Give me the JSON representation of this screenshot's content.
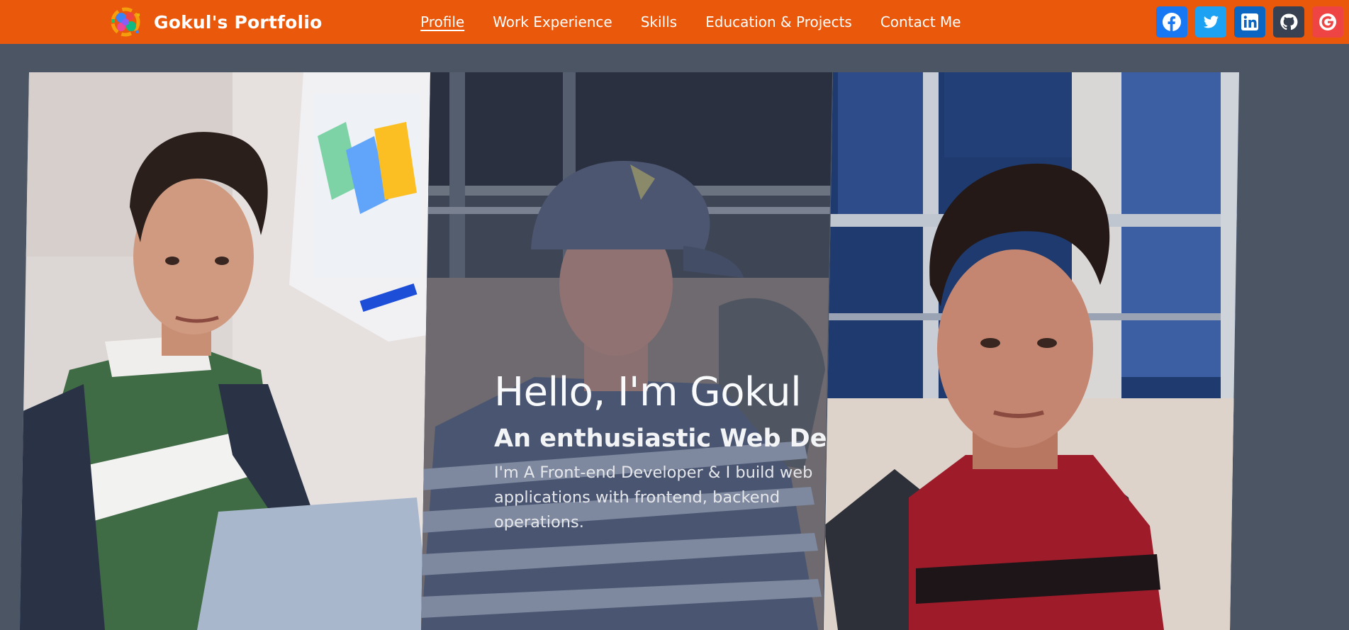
{
  "navbar": {
    "brand": "Gokul's Portfolio",
    "links": [
      {
        "label": "Profile",
        "active": true
      },
      {
        "label": "Work Experience",
        "active": false
      },
      {
        "label": "Skills",
        "active": false
      },
      {
        "label": "Education & Projects",
        "active": false
      },
      {
        "label": "Contact Me",
        "active": false
      }
    ],
    "socials": [
      {
        "icon": "facebook-icon",
        "color": "#1877f2"
      },
      {
        "icon": "twitter-icon",
        "color": "#1da1f2"
      },
      {
        "icon": "linkedin-icon",
        "color": "#0a66c2"
      },
      {
        "icon": "github-icon",
        "color": "#374151"
      },
      {
        "icon": "google-icon",
        "color": "#ef4444"
      }
    ]
  },
  "hero": {
    "title": "Hello, I'm Gokul",
    "subtitle": "An enthusiastic Web Developer",
    "description": "I'm A Front-end Developer & I build web applications with frontend, backend operations."
  },
  "colors": {
    "navbar": "#ea580c",
    "background": "#4b5563"
  }
}
